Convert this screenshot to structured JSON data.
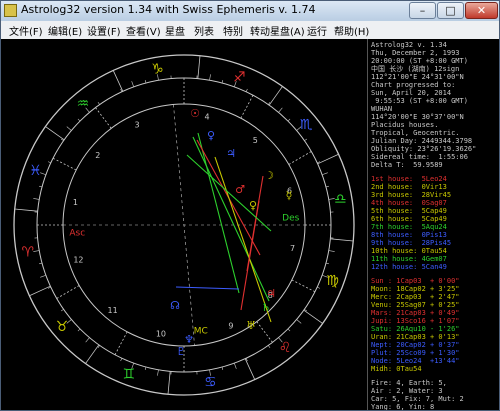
{
  "window": {
    "title": "Astrolog32 version 1.34 with Swiss Ephemeris v. 1.74",
    "min_label": "–",
    "max_label": "□",
    "close_label": "✕"
  },
  "menu": [
    "文件(F)",
    "编辑(E)",
    "设置(F)",
    "查看(V)",
    "星盘",
    "列表",
    "特别",
    "转动星盘(A)",
    "运行",
    "帮助(H)"
  ],
  "colors": {
    "background": "#000000",
    "outer_ring": "#c8c8c8",
    "fire": "#e03030",
    "earth": "#c8c800",
    "air": "#2dd02d",
    "water": "#3c5cff",
    "panel_text": "#c8c8c8"
  },
  "chart": {
    "zodiac_signs": [
      {
        "glyph": "♈",
        "element": "fire"
      },
      {
        "glyph": "♉",
        "element": "earth"
      },
      {
        "glyph": "♊",
        "element": "air"
      },
      {
        "glyph": "♋",
        "element": "water"
      },
      {
        "glyph": "♌",
        "element": "fire"
      },
      {
        "glyph": "♍",
        "element": "earth"
      },
      {
        "glyph": "♎",
        "element": "air"
      },
      {
        "glyph": "♏",
        "element": "water"
      },
      {
        "glyph": "♐",
        "element": "fire"
      },
      {
        "glyph": "♑",
        "element": "earth"
      },
      {
        "glyph": "♒",
        "element": "air"
      },
      {
        "glyph": "♓",
        "element": "water"
      }
    ],
    "house_numbers": [
      "1",
      "2",
      "3",
      "4",
      "5",
      "6",
      "7",
      "8",
      "9",
      "10",
      "11",
      "12"
    ],
    "angles": {
      "asc": "Asc",
      "desc": "Des",
      "mc": "MC"
    },
    "planet_glyphs": [
      {
        "glyph": "☉",
        "element": "fire"
      },
      {
        "glyph": "☽",
        "element": "earth"
      },
      {
        "glyph": "☿",
        "element": "earth"
      },
      {
        "glyph": "♀",
        "element": "earth"
      },
      {
        "glyph": "♂",
        "element": "fire"
      },
      {
        "glyph": "♃",
        "element": "fire"
      },
      {
        "glyph": "♄",
        "element": "air"
      },
      {
        "glyph": "♅",
        "element": "earth"
      },
      {
        "glyph": "♆",
        "element": "water"
      },
      {
        "glyph": "♇",
        "element": "water"
      },
      {
        "glyph": "☊",
        "element": "water"
      },
      {
        "glyph": "♃",
        "element": "water"
      },
      {
        "glyph": "♀",
        "element": "water"
      }
    ]
  },
  "panel": {
    "header": [
      "Astrolog32 v. 1.34",
      "Thu, December 2, 1993",
      "20:00:00 (ST +8:00 GMT)",
      "中国 长沙 (湖南) 12sign",
      "112°21'00\"E 24°31'00\"N",
      "Chart progressed to:",
      "Sun, April 20, 2014",
      " 9:55:53 (ST +8:00 GMT)",
      "WUHAN",
      "114°20'00\"E 30°37'00\"N",
      "Placidus houses.",
      "Tropical, Geocentric.",
      "Julian Day: 2449344.3798",
      "Obliquity: 23°26'19.3626\"",
      "Sidereal time:  1:55:06",
      "Delta T:  59.9589"
    ],
    "houses": [
      {
        "label": "1st house:",
        "value": "5Leo24",
        "color": "fire"
      },
      {
        "label": "2nd house:",
        "value": "0Vir13",
        "color": "earth"
      },
      {
        "label": "3rd house:",
        "value": "28Vir45",
        "color": "earth"
      },
      {
        "label": "4th house:",
        "value": "0Sag07",
        "color": "fire"
      },
      {
        "label": "5th house:",
        "value": "5Cap49",
        "color": "earth"
      },
      {
        "label": "6th house:",
        "value": "5Cap49",
        "color": "earth"
      },
      {
        "label": "7th house:",
        "value": "5Aqu24",
        "color": "air"
      },
      {
        "label": "8th house:",
        "value": "0Pis13",
        "color": "water"
      },
      {
        "label": "9th house:",
        "value": "28Pis45",
        "color": "water"
      },
      {
        "label": "10th house:",
        "value": "0Tau54",
        "color": "earth"
      },
      {
        "label": "11th house:",
        "value": "4Gem07",
        "color": "air"
      },
      {
        "label": "12th house:",
        "value": "5Can49",
        "color": "water"
      }
    ],
    "planets": [
      {
        "name": "Sun :",
        "value": "1Cap03",
        "extra": "+ 0'00\"",
        "color": "fire"
      },
      {
        "name": "Moon:",
        "value": "18Cap02",
        "extra": "+ 3'25\"",
        "color": "earth"
      },
      {
        "name": "Merc:",
        "value": "2Cap03",
        "extra": "+ 2'47\"",
        "color": "earth"
      },
      {
        "name": "Venu:",
        "value": "25Sag07",
        "extra": "+ 0'25\"",
        "color": "earth"
      },
      {
        "name": "Mars:",
        "value": "21Cap03",
        "extra": "+ 0'49\"",
        "color": "fire"
      },
      {
        "name": "Jupi:",
        "value": "13Sco16",
        "extra": "+ 1'07\"",
        "color": "fire"
      },
      {
        "name": "Satu:",
        "value": "26Aqu10",
        "extra": "- 1'26\"",
        "color": "air"
      },
      {
        "name": "Uran:",
        "value": "21Cap03",
        "extra": "+ 0'13\"",
        "color": "earth"
      },
      {
        "name": "Nept:",
        "value": "20Cap02",
        "extra": "+ 0'37\"",
        "color": "water"
      },
      {
        "name": "Plut:",
        "value": "25Sco09",
        "extra": "+ 1'30\"",
        "color": "water"
      },
      {
        "name": "Node:",
        "value": "5Leo24",
        "extra": "+13'44\"",
        "color": "water"
      },
      {
        "name": "Midh:",
        "value": "0Tau54",
        "extra": "",
        "color": "earth"
      }
    ],
    "footer": [
      "Fire: 4, Earth: 5,",
      "Air : 2, Water: 3",
      "Car: 5, Fix: 7, Mut: 2",
      "Yang: 6, Yin: 8",
      "M: 2, N: 8, A: 0, D: 10"
    ]
  }
}
